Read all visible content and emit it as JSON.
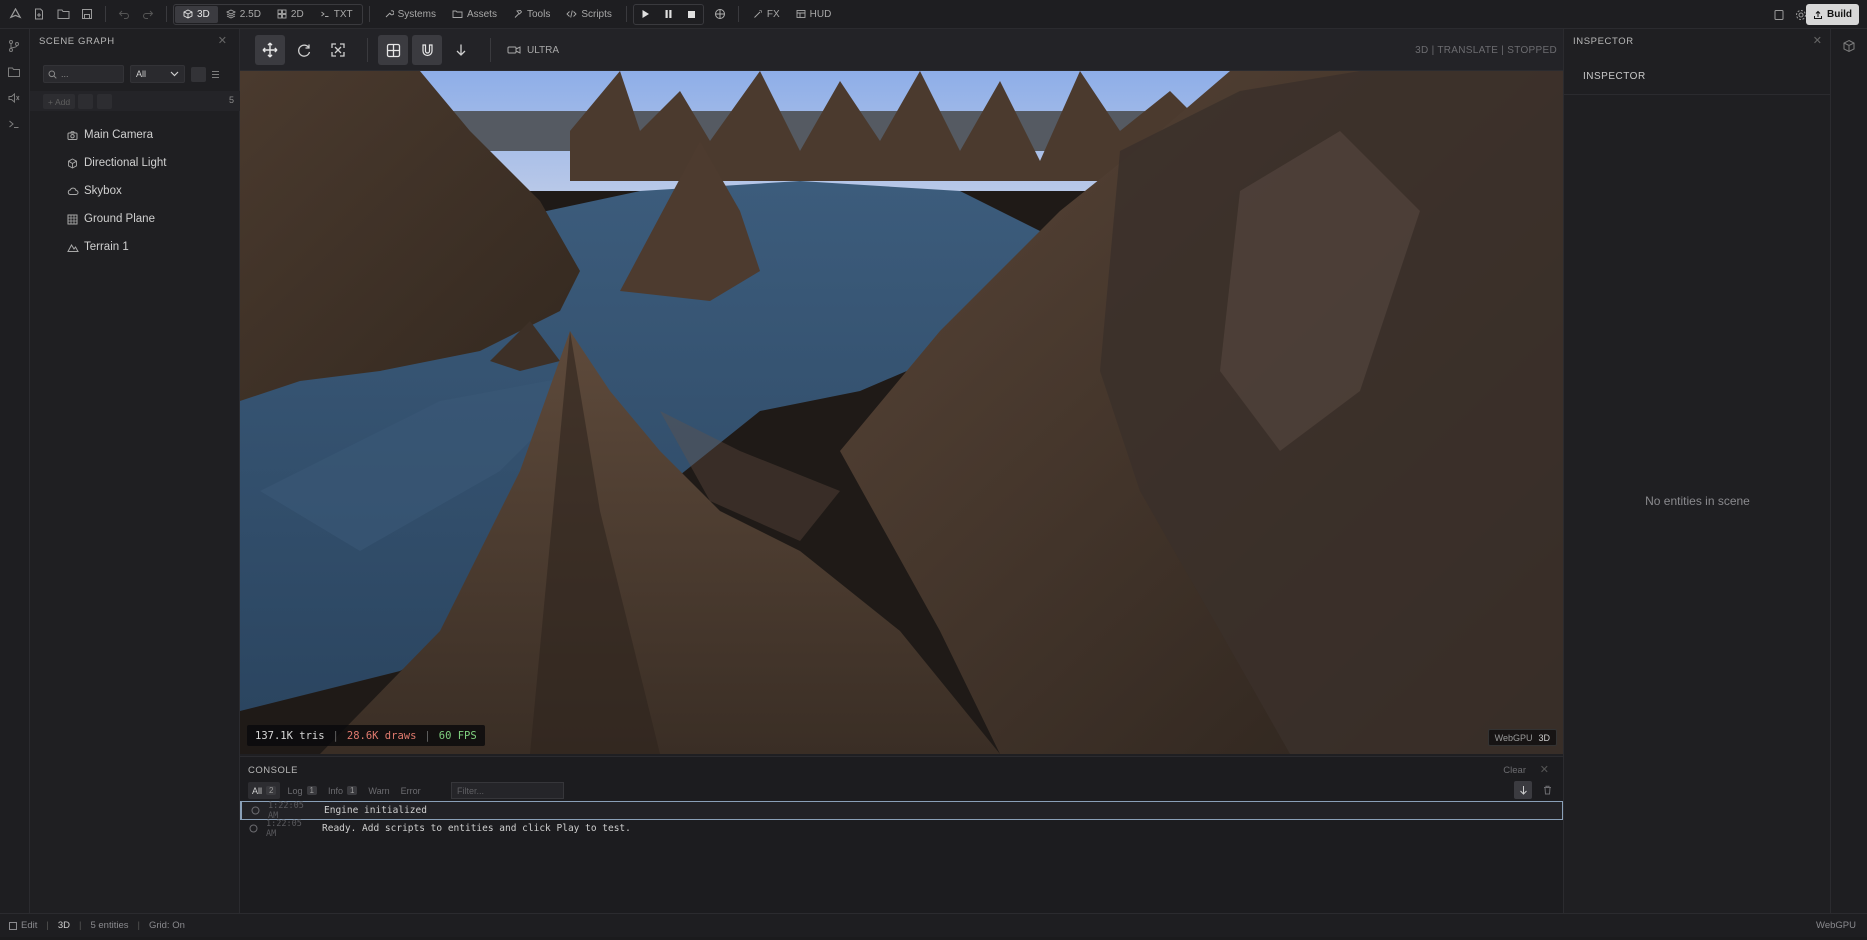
{
  "topbar": {
    "modes": [
      {
        "label": "3D",
        "icon": "cube-icon",
        "active": true
      },
      {
        "label": "2.5D",
        "icon": "layers-icon",
        "active": false
      },
      {
        "label": "2D",
        "icon": "grid-icon",
        "active": false
      },
      {
        "label": "TXT",
        "icon": "terminal-icon",
        "active": false
      }
    ],
    "menus": [
      {
        "label": "Systems",
        "icon": "wrench-icon"
      },
      {
        "label": "Assets",
        "icon": "folder-icon"
      },
      {
        "label": "Tools",
        "icon": "hammer-icon"
      },
      {
        "label": "Scripts",
        "icon": "code-icon"
      }
    ],
    "fx_label": "FX",
    "hud_label": "HUD",
    "build_label": "Build"
  },
  "scene_graph": {
    "title": "SCENE GRAPH",
    "search_placeholder": "...",
    "filter_value": "All",
    "add_label": "Add",
    "entity_count": "5",
    "entities": [
      {
        "name": "Main Camera",
        "icon": "camera-icon"
      },
      {
        "name": "Directional Light",
        "icon": "light-icon"
      },
      {
        "name": "Skybox",
        "icon": "cloud-icon"
      },
      {
        "name": "Ground Plane",
        "icon": "grid-icon"
      },
      {
        "name": "Terrain 1",
        "icon": "mountain-icon"
      }
    ]
  },
  "viewport": {
    "quality_label": "ULTRA",
    "status": "3D | TRANSLATE | STOPPED",
    "stats": {
      "tris": "137.1K tris",
      "draws": "28.6K draws",
      "fps": "60 FPS"
    },
    "renderer": "WebGPU",
    "renderer_mode": "3D"
  },
  "console": {
    "title": "CONSOLE",
    "clear_label": "Clear",
    "tabs": [
      {
        "label": "All",
        "count": "2",
        "active": true
      },
      {
        "label": "Log",
        "count": "1",
        "active": false
      },
      {
        "label": "Info",
        "count": "1",
        "active": false
      },
      {
        "label": "Warn",
        "count": "",
        "active": false
      },
      {
        "label": "Error",
        "count": "",
        "active": false
      }
    ],
    "filter_placeholder": "Filter...",
    "messages": [
      {
        "time": "1:22:05 AM",
        "text": "Engine initialized"
      },
      {
        "time": "1:22:05 AM",
        "text": "Ready. Add scripts to entities and click Play to test."
      }
    ]
  },
  "inspector": {
    "title": "INSPECTOR",
    "subtitle": "INSPECTOR",
    "empty_text": "No entities in scene"
  },
  "statusbar": {
    "mode": "Edit",
    "view": "3D",
    "entities": "5 entities",
    "grid": "Grid: On",
    "renderer": "WebGPU"
  },
  "colors": {
    "accent_selection": "#8aa0b8",
    "stat_tris": "#d8d8d8",
    "stat_draws": "#e07a6e",
    "stat_fps": "#7fcf7f",
    "build_bg": "#d8d8d8"
  }
}
